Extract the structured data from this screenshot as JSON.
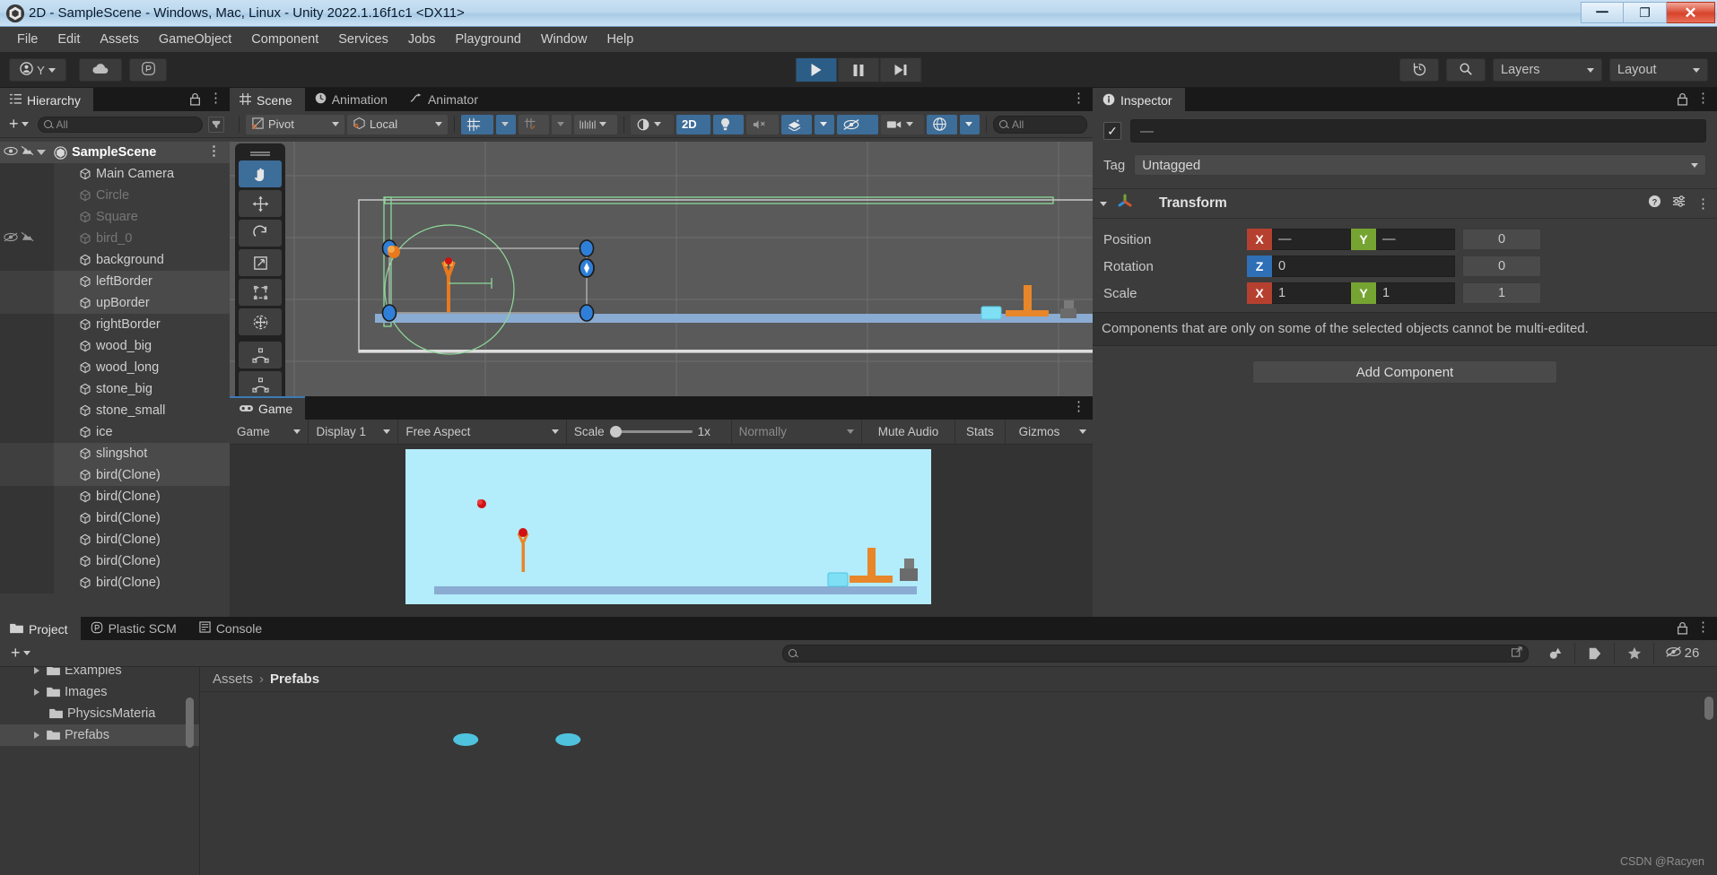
{
  "window": {
    "title": "2D - SampleScene - Windows, Mac, Linux - Unity 2022.1.16f1c1 <DX11>",
    "minimize": "—",
    "maximize": "❐",
    "close": "✕"
  },
  "menubar": {
    "items": [
      "File",
      "Edit",
      "Assets",
      "GameObject",
      "Component",
      "Services",
      "Jobs",
      "Playground",
      "Window",
      "Help"
    ]
  },
  "toolbar": {
    "account_label": "Y",
    "cloud_label": "cloud-icon",
    "plastic_label": "plastic-scm-icon",
    "play": "play-icon",
    "pause": "pause-icon",
    "step": "step-icon",
    "history": "history-icon",
    "search": "search-icon",
    "layers": "Layers",
    "layout": "Layout"
  },
  "hierarchy": {
    "tab": "Hierarchy",
    "search_placeholder": "All",
    "plus": "+",
    "root": "SampleScene",
    "items": [
      {
        "name": "Main Camera",
        "dim": false,
        "selected": false,
        "hidden": false
      },
      {
        "name": "Circle",
        "dim": true,
        "selected": false,
        "hidden": false
      },
      {
        "name": "Square",
        "dim": true,
        "selected": false,
        "hidden": false
      },
      {
        "name": "bird_0",
        "dim": true,
        "selected": false,
        "hidden": true
      },
      {
        "name": "background",
        "dim": false,
        "selected": false,
        "hidden": false
      },
      {
        "name": "leftBorder",
        "dim": false,
        "selected": true,
        "hidden": false
      },
      {
        "name": "upBorder",
        "dim": false,
        "selected": true,
        "hidden": false
      },
      {
        "name": "rightBorder",
        "dim": false,
        "selected": false,
        "hidden": false
      },
      {
        "name": "wood_big",
        "dim": false,
        "selected": false,
        "hidden": false
      },
      {
        "name": "wood_long",
        "dim": false,
        "selected": false,
        "hidden": false
      },
      {
        "name": "stone_big",
        "dim": false,
        "selected": false,
        "hidden": false
      },
      {
        "name": "stone_small",
        "dim": false,
        "selected": false,
        "hidden": false
      },
      {
        "name": "ice",
        "dim": false,
        "selected": false,
        "hidden": false
      },
      {
        "name": "slingshot",
        "dim": false,
        "selected": true,
        "hidden": false
      },
      {
        "name": "bird(Clone)",
        "dim": false,
        "selected": true,
        "hidden": false
      },
      {
        "name": "bird(Clone)",
        "dim": false,
        "selected": false,
        "hidden": false
      },
      {
        "name": "bird(Clone)",
        "dim": false,
        "selected": false,
        "hidden": false
      },
      {
        "name": "bird(Clone)",
        "dim": false,
        "selected": false,
        "hidden": false
      },
      {
        "name": "bird(Clone)",
        "dim": false,
        "selected": false,
        "hidden": false
      },
      {
        "name": "bird(Clone)",
        "dim": false,
        "selected": false,
        "hidden": false
      }
    ]
  },
  "scene": {
    "tabs": [
      {
        "label": "Scene",
        "icon": "grid-icon",
        "active": true
      },
      {
        "label": "Animation",
        "icon": "clock-icon",
        "active": false
      },
      {
        "label": "Animator",
        "icon": "animator-icon",
        "active": false
      }
    ],
    "toolbar": {
      "pivot": "Pivot",
      "space": "Local",
      "grid": "grid-snap-icon",
      "snap": "snap-increment-icon",
      "ruler": "ruler-icon",
      "shading": "shading-mode-icon",
      "mode_2d": "2D",
      "light": "light-icon",
      "audio": "audio-mute-icon",
      "fx": "effects-icon",
      "hidden": "hidden-objects-icon",
      "camera": "scene-camera-icon",
      "gizmos": "gizmos-icon",
      "search_placeholder": "All"
    },
    "tools": [
      "hand-tool",
      "move-tool",
      "rotate-tool",
      "scale-tool",
      "rect-tool",
      "transform-tool",
      "custom-tool-1",
      "custom-tool-2"
    ]
  },
  "game": {
    "tab": "Game",
    "controls": {
      "target": "Game",
      "display": "Display 1",
      "aspect": "Free Aspect",
      "scale_label": "Scale",
      "scale_value": "1x",
      "playmode": "Normally",
      "mute": "Mute Audio",
      "stats": "Stats",
      "gizmos": "Gizmos"
    }
  },
  "inspector": {
    "tab": "Inspector",
    "name_value": "—",
    "tag_label": "Tag",
    "tag_value": "Untagged",
    "component": {
      "title": "Transform",
      "help": "?",
      "preset": "preset-icon",
      "menu": "⋮",
      "rows": [
        {
          "label": "Position",
          "a1": "X",
          "v1": "—",
          "a2": "Y",
          "v2": "—",
          "v3": "0"
        },
        {
          "label": "Rotation",
          "a1": "Z",
          "v1": "0",
          "a2": "",
          "v2": "",
          "v3": "0"
        },
        {
          "label": "Scale",
          "a1": "X",
          "v1": "1",
          "a2": "Y",
          "v2": "1",
          "v3": "1"
        }
      ]
    },
    "multi_edit_message": "Components that are only on some of the selected objects cannot be multi-edited.",
    "add_component": "Add Component"
  },
  "project": {
    "tabs": [
      {
        "label": "Project",
        "icon": "folder-icon",
        "active": true
      },
      {
        "label": "Plastic SCM",
        "icon": "plastic-icon",
        "active": false
      },
      {
        "label": "Console",
        "icon": "console-icon",
        "active": false
      }
    ],
    "search_placeholder": "",
    "hidden_count": "26",
    "tree": [
      {
        "name": "Examples",
        "expandable": true,
        "selected": false
      },
      {
        "name": "Images",
        "expandable": true,
        "selected": false
      },
      {
        "name": "PhysicsMateria",
        "expandable": false,
        "selected": false
      },
      {
        "name": "Prefabs",
        "expandable": true,
        "selected": true
      }
    ],
    "breadcrumb": [
      "Assets",
      "Prefabs"
    ]
  },
  "watermark": "CSDN @Racyen",
  "colors": {
    "accent_blue": "#3d6d99",
    "axis_x": "#b6402f",
    "axis_y": "#76a432",
    "axis_z": "#2f6fb5",
    "panel_bg": "#3c3c3c",
    "sky": "#b3ecfb"
  }
}
